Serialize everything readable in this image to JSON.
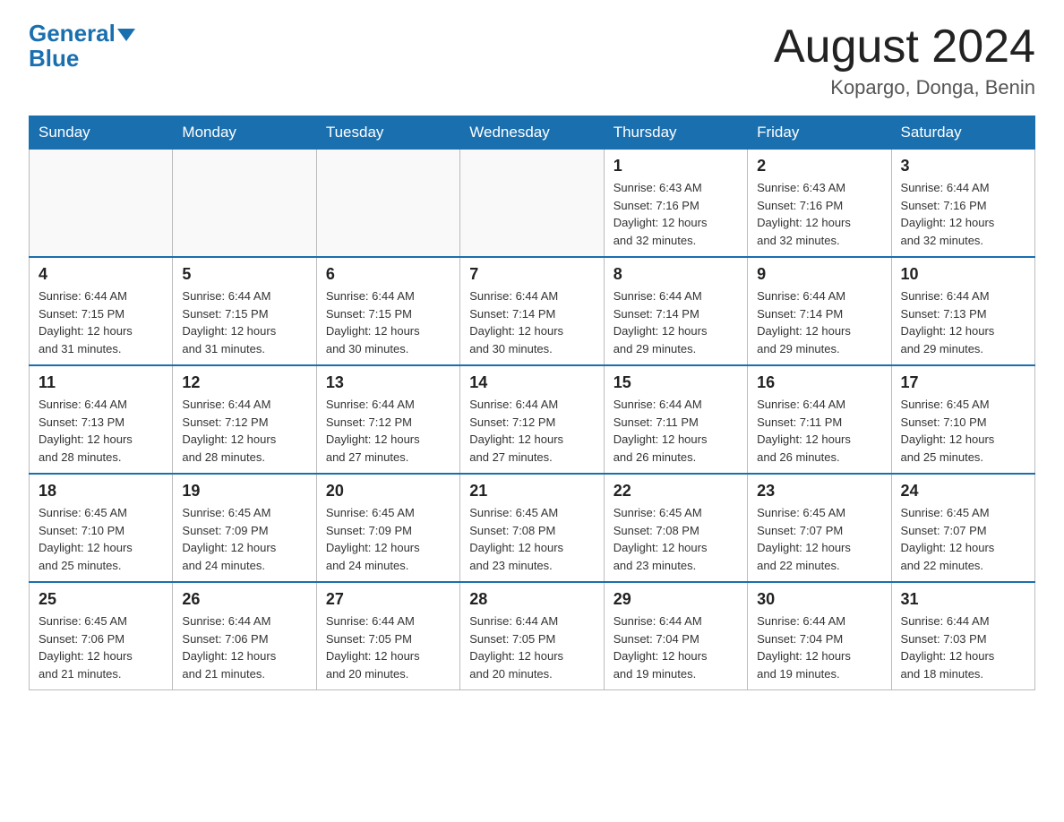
{
  "header": {
    "logo_general": "General",
    "logo_blue": "Blue",
    "month_title": "August 2024",
    "location": "Kopargo, Donga, Benin"
  },
  "days_of_week": [
    "Sunday",
    "Monday",
    "Tuesday",
    "Wednesday",
    "Thursday",
    "Friday",
    "Saturday"
  ],
  "weeks": [
    {
      "days": [
        {
          "date": "",
          "detail": ""
        },
        {
          "date": "",
          "detail": ""
        },
        {
          "date": "",
          "detail": ""
        },
        {
          "date": "",
          "detail": ""
        },
        {
          "date": "1",
          "detail": "Sunrise: 6:43 AM\nSunset: 7:16 PM\nDaylight: 12 hours\nand 32 minutes."
        },
        {
          "date": "2",
          "detail": "Sunrise: 6:43 AM\nSunset: 7:16 PM\nDaylight: 12 hours\nand 32 minutes."
        },
        {
          "date": "3",
          "detail": "Sunrise: 6:44 AM\nSunset: 7:16 PM\nDaylight: 12 hours\nand 32 minutes."
        }
      ]
    },
    {
      "days": [
        {
          "date": "4",
          "detail": "Sunrise: 6:44 AM\nSunset: 7:15 PM\nDaylight: 12 hours\nand 31 minutes."
        },
        {
          "date": "5",
          "detail": "Sunrise: 6:44 AM\nSunset: 7:15 PM\nDaylight: 12 hours\nand 31 minutes."
        },
        {
          "date": "6",
          "detail": "Sunrise: 6:44 AM\nSunset: 7:15 PM\nDaylight: 12 hours\nand 30 minutes."
        },
        {
          "date": "7",
          "detail": "Sunrise: 6:44 AM\nSunset: 7:14 PM\nDaylight: 12 hours\nand 30 minutes."
        },
        {
          "date": "8",
          "detail": "Sunrise: 6:44 AM\nSunset: 7:14 PM\nDaylight: 12 hours\nand 29 minutes."
        },
        {
          "date": "9",
          "detail": "Sunrise: 6:44 AM\nSunset: 7:14 PM\nDaylight: 12 hours\nand 29 minutes."
        },
        {
          "date": "10",
          "detail": "Sunrise: 6:44 AM\nSunset: 7:13 PM\nDaylight: 12 hours\nand 29 minutes."
        }
      ]
    },
    {
      "days": [
        {
          "date": "11",
          "detail": "Sunrise: 6:44 AM\nSunset: 7:13 PM\nDaylight: 12 hours\nand 28 minutes."
        },
        {
          "date": "12",
          "detail": "Sunrise: 6:44 AM\nSunset: 7:12 PM\nDaylight: 12 hours\nand 28 minutes."
        },
        {
          "date": "13",
          "detail": "Sunrise: 6:44 AM\nSunset: 7:12 PM\nDaylight: 12 hours\nand 27 minutes."
        },
        {
          "date": "14",
          "detail": "Sunrise: 6:44 AM\nSunset: 7:12 PM\nDaylight: 12 hours\nand 27 minutes."
        },
        {
          "date": "15",
          "detail": "Sunrise: 6:44 AM\nSunset: 7:11 PM\nDaylight: 12 hours\nand 26 minutes."
        },
        {
          "date": "16",
          "detail": "Sunrise: 6:44 AM\nSunset: 7:11 PM\nDaylight: 12 hours\nand 26 minutes."
        },
        {
          "date": "17",
          "detail": "Sunrise: 6:45 AM\nSunset: 7:10 PM\nDaylight: 12 hours\nand 25 minutes."
        }
      ]
    },
    {
      "days": [
        {
          "date": "18",
          "detail": "Sunrise: 6:45 AM\nSunset: 7:10 PM\nDaylight: 12 hours\nand 25 minutes."
        },
        {
          "date": "19",
          "detail": "Sunrise: 6:45 AM\nSunset: 7:09 PM\nDaylight: 12 hours\nand 24 minutes."
        },
        {
          "date": "20",
          "detail": "Sunrise: 6:45 AM\nSunset: 7:09 PM\nDaylight: 12 hours\nand 24 minutes."
        },
        {
          "date": "21",
          "detail": "Sunrise: 6:45 AM\nSunset: 7:08 PM\nDaylight: 12 hours\nand 23 minutes."
        },
        {
          "date": "22",
          "detail": "Sunrise: 6:45 AM\nSunset: 7:08 PM\nDaylight: 12 hours\nand 23 minutes."
        },
        {
          "date": "23",
          "detail": "Sunrise: 6:45 AM\nSunset: 7:07 PM\nDaylight: 12 hours\nand 22 minutes."
        },
        {
          "date": "24",
          "detail": "Sunrise: 6:45 AM\nSunset: 7:07 PM\nDaylight: 12 hours\nand 22 minutes."
        }
      ]
    },
    {
      "days": [
        {
          "date": "25",
          "detail": "Sunrise: 6:45 AM\nSunset: 7:06 PM\nDaylight: 12 hours\nand 21 minutes."
        },
        {
          "date": "26",
          "detail": "Sunrise: 6:44 AM\nSunset: 7:06 PM\nDaylight: 12 hours\nand 21 minutes."
        },
        {
          "date": "27",
          "detail": "Sunrise: 6:44 AM\nSunset: 7:05 PM\nDaylight: 12 hours\nand 20 minutes."
        },
        {
          "date": "28",
          "detail": "Sunrise: 6:44 AM\nSunset: 7:05 PM\nDaylight: 12 hours\nand 20 minutes."
        },
        {
          "date": "29",
          "detail": "Sunrise: 6:44 AM\nSunset: 7:04 PM\nDaylight: 12 hours\nand 19 minutes."
        },
        {
          "date": "30",
          "detail": "Sunrise: 6:44 AM\nSunset: 7:04 PM\nDaylight: 12 hours\nand 19 minutes."
        },
        {
          "date": "31",
          "detail": "Sunrise: 6:44 AM\nSunset: 7:03 PM\nDaylight: 12 hours\nand 18 minutes."
        }
      ]
    }
  ]
}
